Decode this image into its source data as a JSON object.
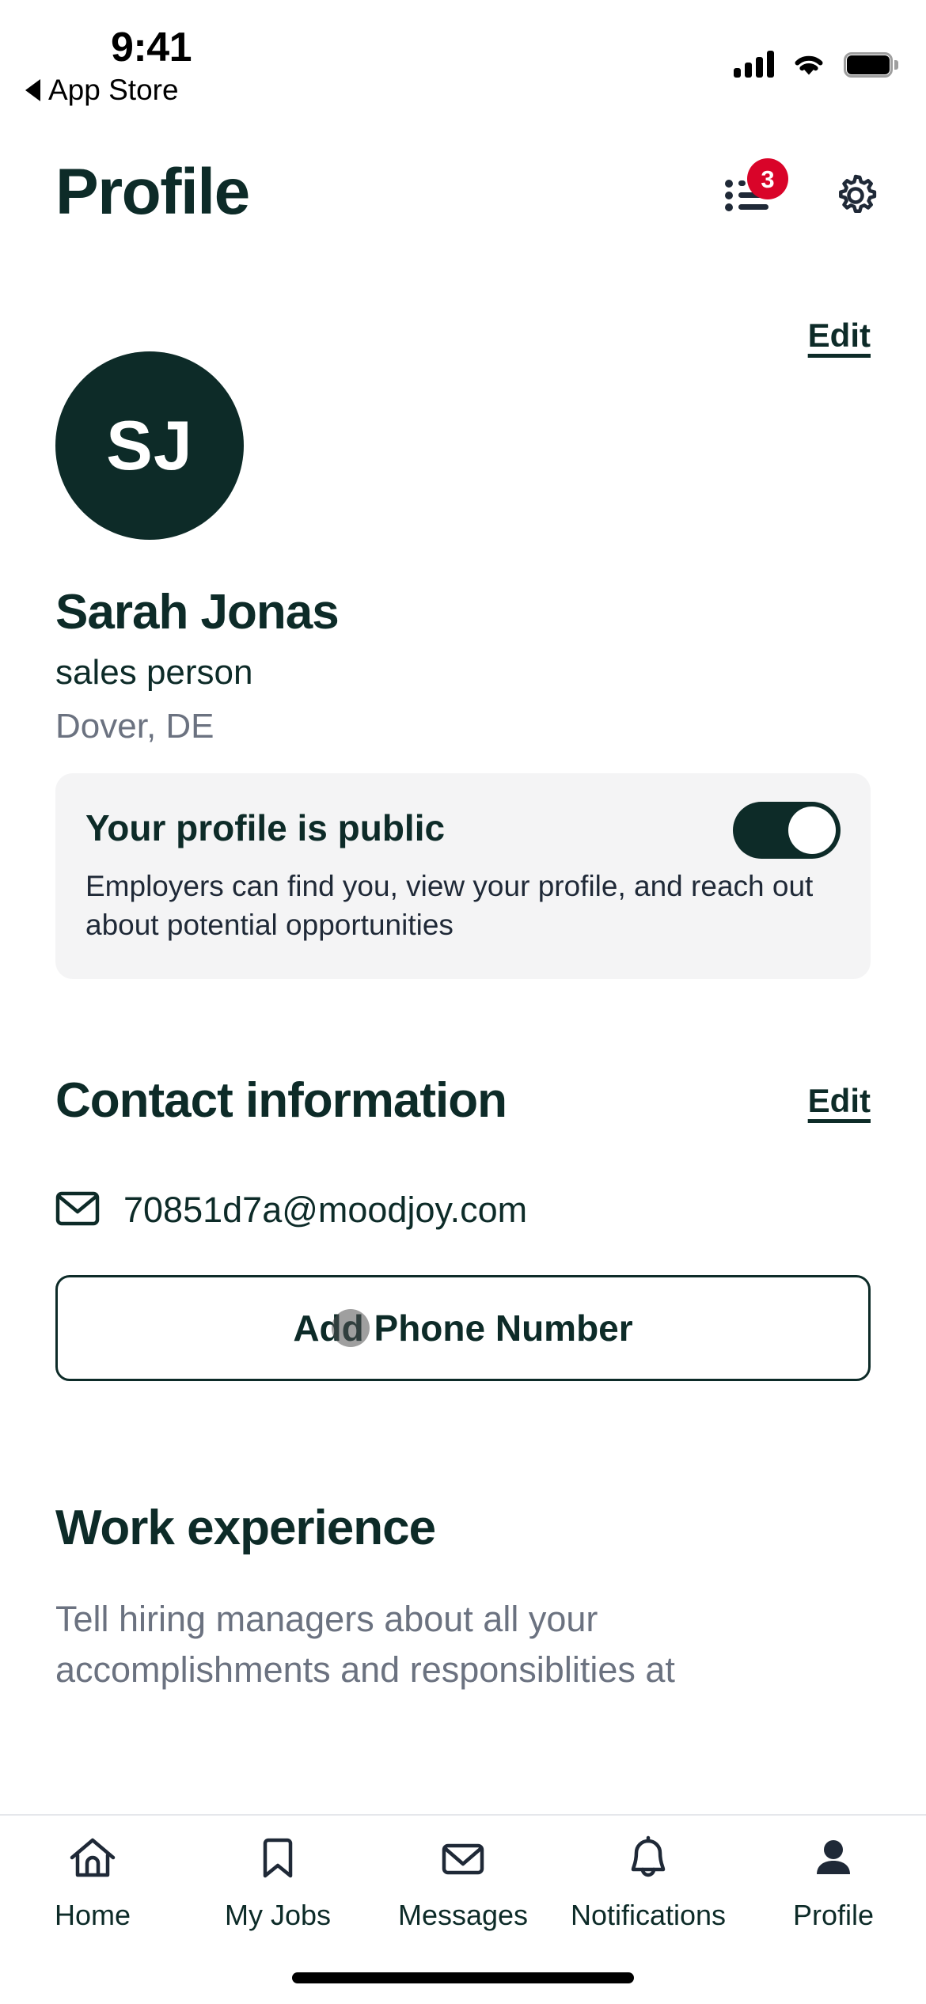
{
  "status_bar": {
    "time": "9:41",
    "back_label": "App Store",
    "back_icon": "triangle-left-icon",
    "signal_icon": "cellular-signal-icon",
    "wifi_icon": "wifi-icon",
    "battery_icon": "battery-full-icon"
  },
  "header": {
    "title": "Profile",
    "list_icon": "bulleted-list-icon",
    "badge_count": "3",
    "settings_icon": "gear-icon"
  },
  "profile": {
    "avatar_initials": "SJ",
    "edit_label": "Edit",
    "name": "Sarah Jonas",
    "role": "sales person",
    "location": "Dover, DE"
  },
  "public_card": {
    "title": "Your profile is public",
    "description": "Employers can find you, view your profile, and reach out about potential opportunities",
    "toggle_state": "on"
  },
  "contact": {
    "section_title": "Contact information",
    "edit_label": "Edit",
    "email_icon": "envelope-icon",
    "email": "70851d7a@moodjoy.com",
    "add_phone_label": "Add Phone Number"
  },
  "work_experience": {
    "title": "Work experience",
    "description": "Tell hiring managers about all your accomplishments and responsiblities at"
  },
  "tab_bar": {
    "items": [
      {
        "label": "Home",
        "icon": "home-icon",
        "active": false
      },
      {
        "label": "My Jobs",
        "icon": "bookmark-icon",
        "active": false
      },
      {
        "label": "Messages",
        "icon": "envelope-icon",
        "active": false
      },
      {
        "label": "Notifications",
        "icon": "bell-icon",
        "active": false
      },
      {
        "label": "Profile",
        "icon": "person-filled-icon",
        "active": true
      }
    ]
  },
  "colors": {
    "brand_dark": "#0D2B28",
    "badge_red": "#D90429",
    "card_gray": "#F4F4F5",
    "text_gray": "#6B7280"
  }
}
